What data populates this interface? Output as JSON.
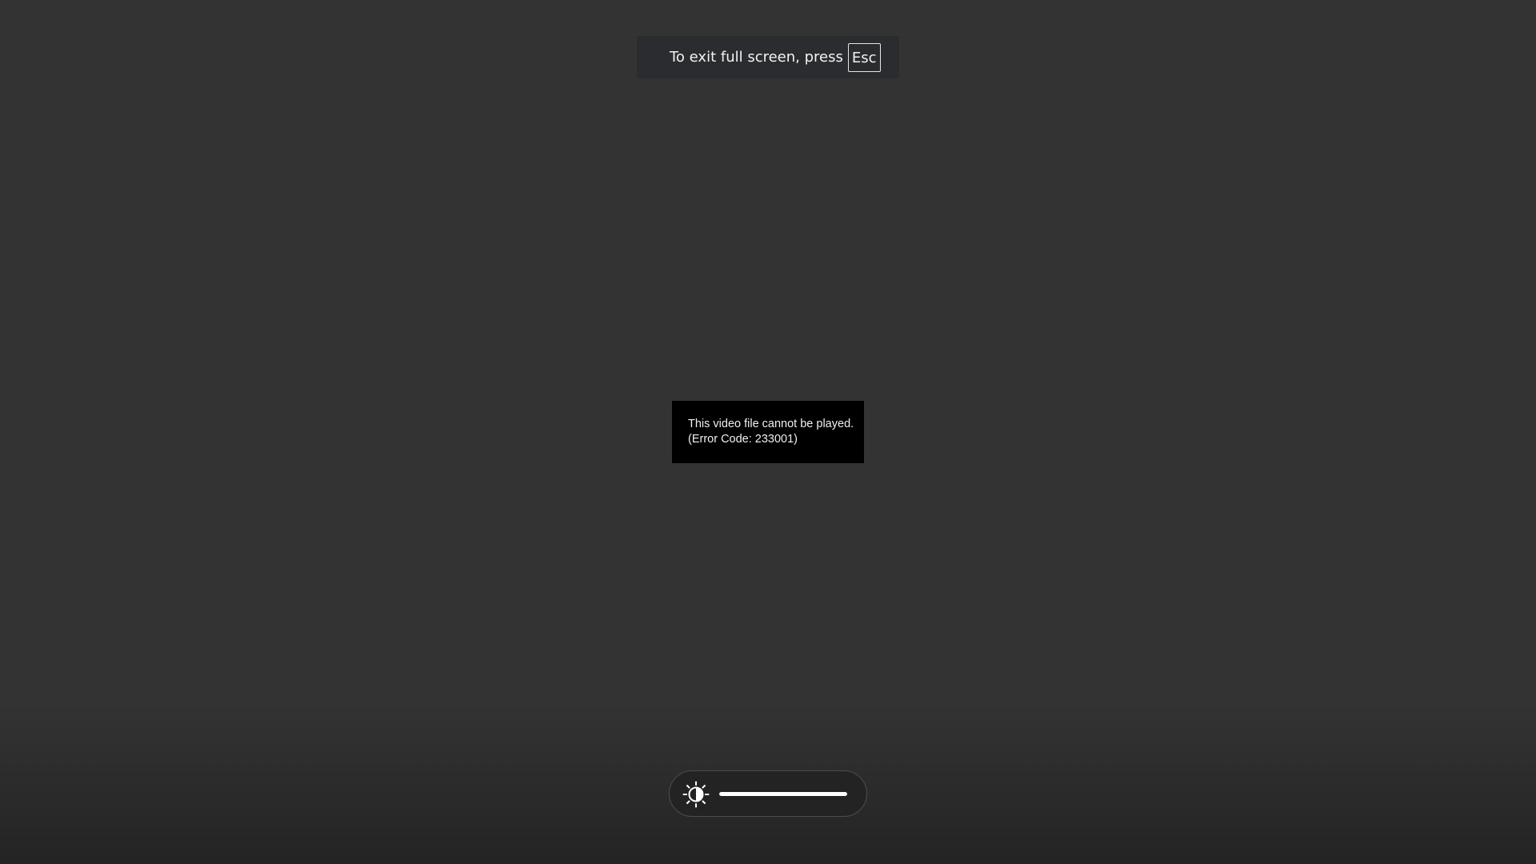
{
  "fullscreen_banner": {
    "message": "To exit full screen, press",
    "key": "Esc"
  },
  "video_error": {
    "line1": "This video file cannot be played.",
    "line2": "(Error Code: 233001)"
  },
  "brightness_osd": {
    "icon": "brightness-icon",
    "level": 1.0
  },
  "colors": {
    "background": "#333333",
    "error_background": "#000000",
    "slider_fill": "#ffffff"
  }
}
